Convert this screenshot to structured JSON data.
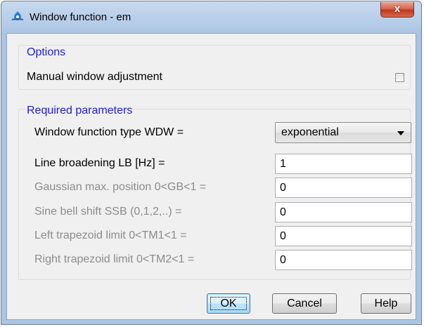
{
  "window": {
    "title": "Window function - em",
    "close_label": "x"
  },
  "options": {
    "title": "Options",
    "manual_adjustment_label": "Manual window adjustment",
    "manual_adjustment_checked": false
  },
  "required": {
    "title": "Required parameters",
    "wdw_label": "Window function type WDW =",
    "wdw_value": "exponential",
    "lb_label": "Line broadening LB [Hz] =",
    "lb_value": "1",
    "gb_label": "Gaussian max. position 0<GB<1 =",
    "gb_value": "0",
    "ssb_label": "Sine bell shift SSB (0,1,2,..) =",
    "ssb_value": "0",
    "tm1_label": "Left trapezoid limit 0<TM1<1 =",
    "tm1_value": "0",
    "tm2_label": "Right trapezoid limit 0<TM2<1 =",
    "tm2_value": "0"
  },
  "buttons": {
    "ok": "OK",
    "cancel": "Cancel",
    "help": "Help"
  },
  "colors": {
    "group_title": "#1f1fd6",
    "disabled_text": "#8c8c8c",
    "close_button": "#c2361c"
  }
}
